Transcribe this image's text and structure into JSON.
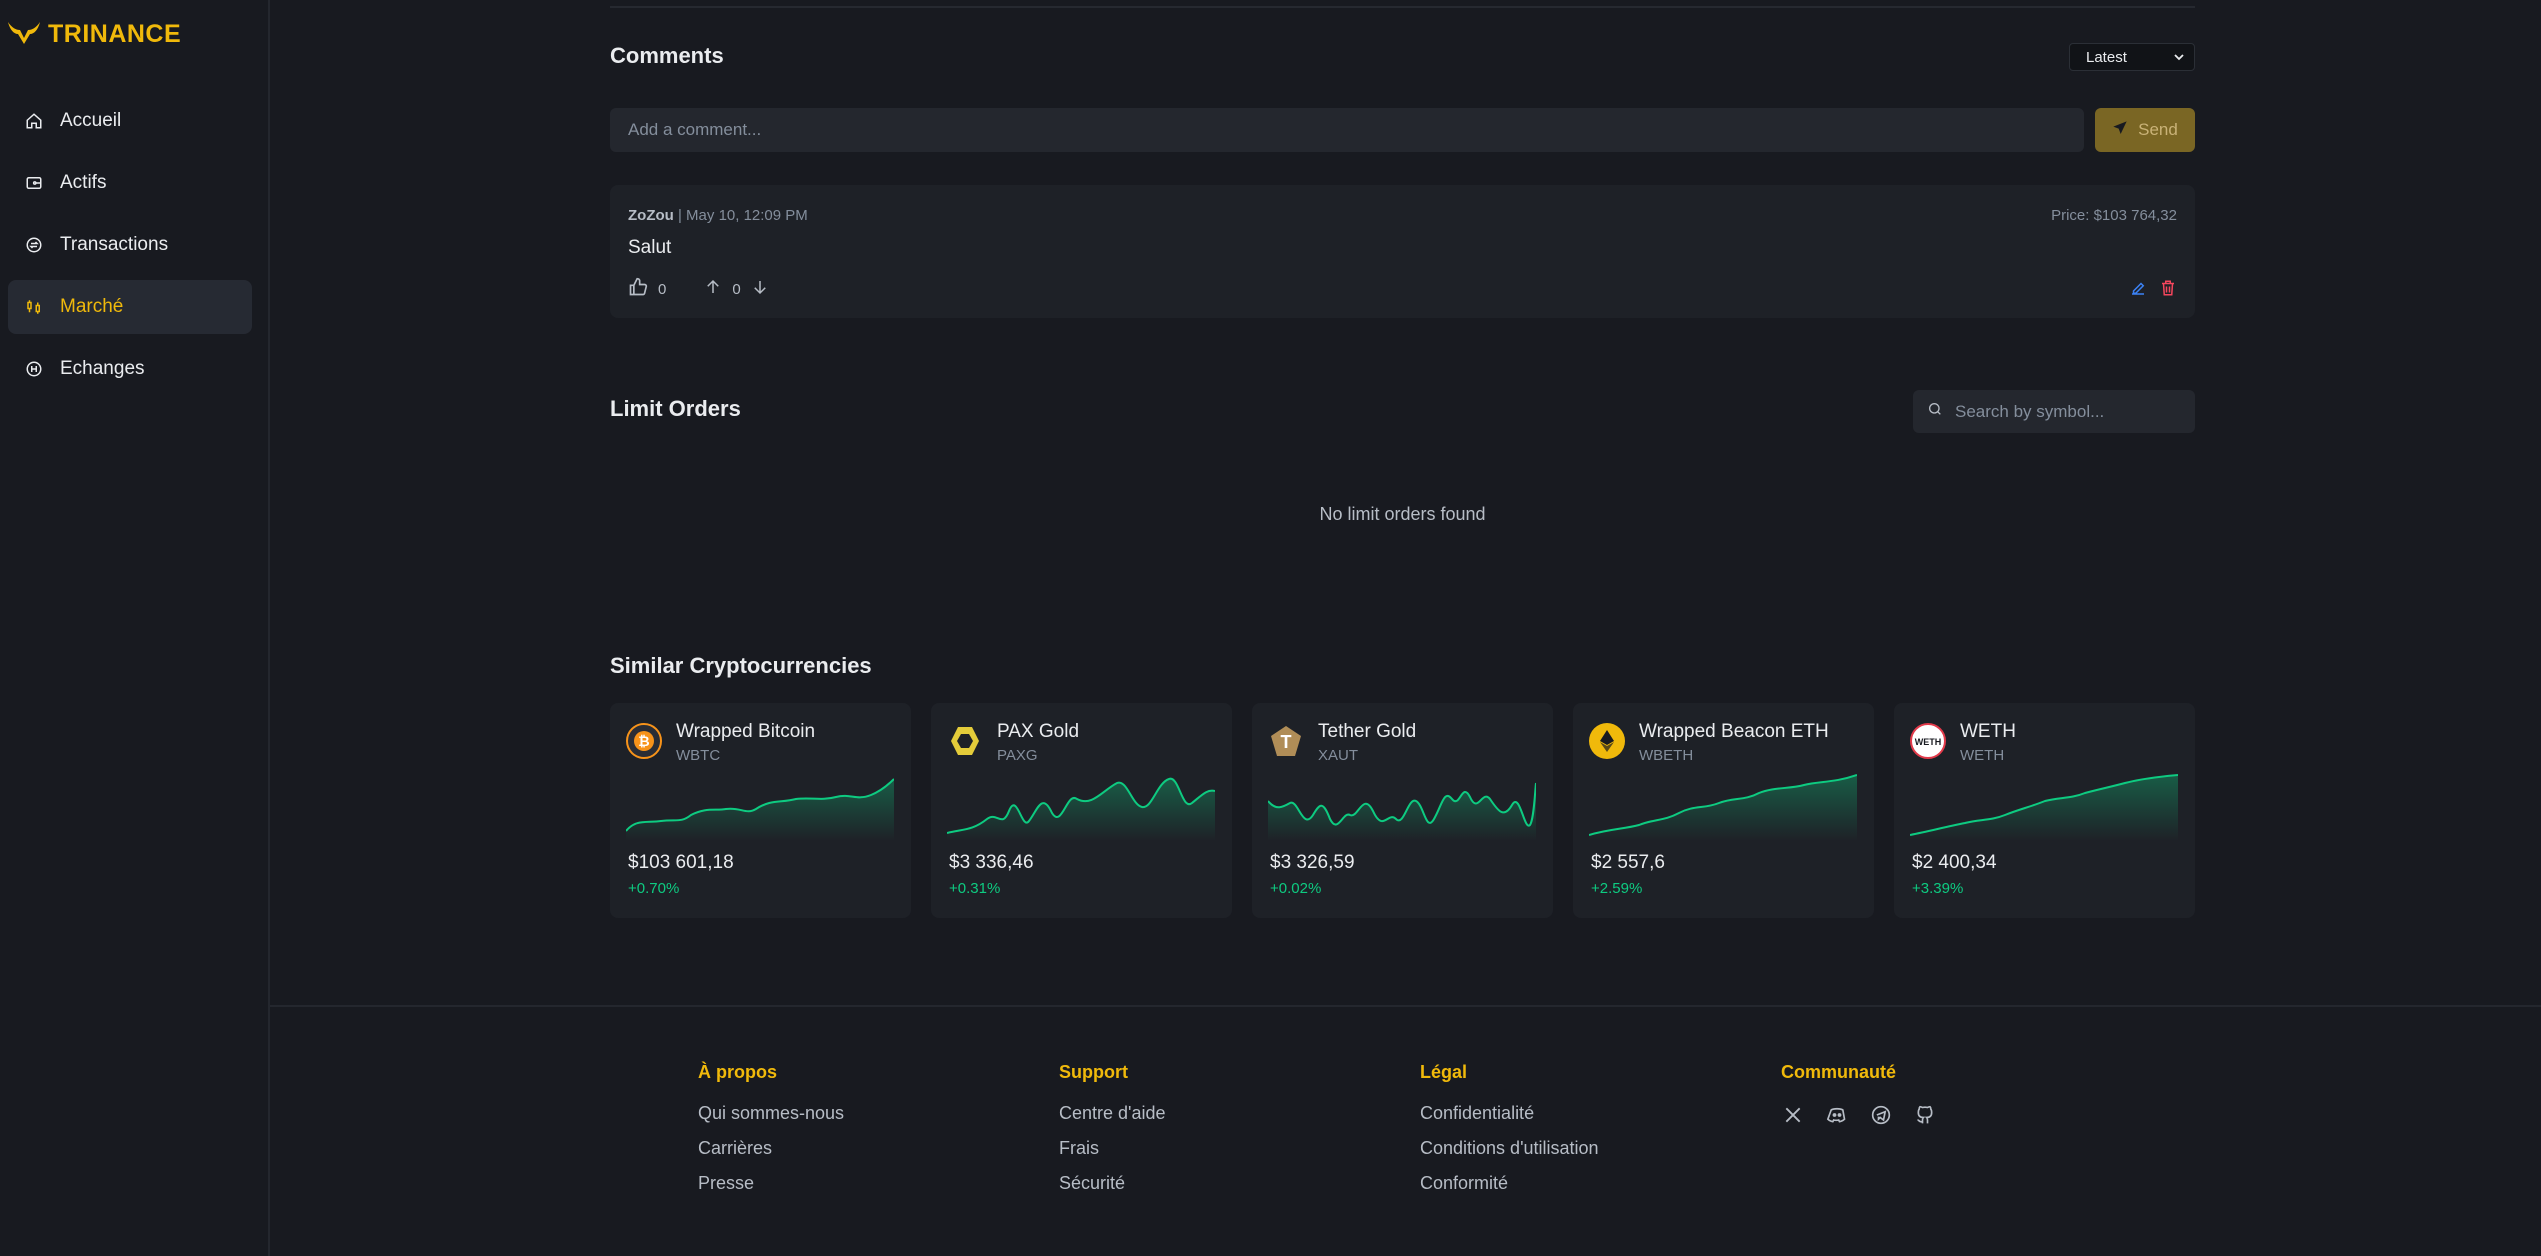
{
  "brand": {
    "name": "TRINANCE",
    "accent": "#f0b90b"
  },
  "sidebar": {
    "items": [
      {
        "label": "Accueil",
        "icon": "home-icon"
      },
      {
        "label": "Actifs",
        "icon": "wallet-icon"
      },
      {
        "label": "Transactions",
        "icon": "transactions-icon"
      },
      {
        "label": "Marché",
        "icon": "market-icon",
        "active": true
      },
      {
        "label": "Echanges",
        "icon": "exchange-icon"
      }
    ]
  },
  "comments": {
    "title": "Comments",
    "sort": "Latest",
    "input_placeholder": "Add a comment...",
    "send_label": "Send",
    "items": [
      {
        "author": "ZoZou",
        "meta": " | May 10, 12:09 PM",
        "price": "Price: $103 764,32",
        "text": "Salut",
        "likes": "0",
        "votes": "0"
      }
    ]
  },
  "limit_orders": {
    "title": "Limit Orders",
    "search_placeholder": "Search by symbol...",
    "empty": "No limit orders found"
  },
  "similar": {
    "title": "Similar Cryptocurrencies",
    "positive_color": "#0ecb81",
    "items": [
      {
        "name": "Wrapped Bitcoin",
        "symbol": "WBTC",
        "price": "$103 601,18",
        "change": "+0.70%",
        "icon": "bitcoin-icon"
      },
      {
        "name": "PAX Gold",
        "symbol": "PAXG",
        "price": "$3 336,46",
        "change": "+0.31%",
        "icon": "paxg-icon"
      },
      {
        "name": "Tether Gold",
        "symbol": "XAUT",
        "price": "$3 326,59",
        "change": "+0.02%",
        "icon": "tether-gold-icon"
      },
      {
        "name": "Wrapped Beacon ETH",
        "symbol": "WBETH",
        "price": "$2 557,6",
        "change": "+2.59%",
        "icon": "ethereum-icon"
      },
      {
        "name": "WETH",
        "symbol": "WETH",
        "price": "$2 400,34",
        "change": "+3.39%",
        "icon": "weth-icon"
      }
    ]
  },
  "footer": {
    "columns": [
      {
        "title": "À propos",
        "links": [
          "Qui sommes-nous",
          "Carrières",
          "Presse"
        ]
      },
      {
        "title": "Support",
        "links": [
          "Centre d'aide",
          "Frais",
          "Sécurité"
        ]
      },
      {
        "title": "Légal",
        "links": [
          "Confidentialité",
          "Conditions d'utilisation",
          "Conformité"
        ]
      },
      {
        "title": "Communauté",
        "social": [
          "x-icon",
          "discord-icon",
          "telegram-icon",
          "github-icon"
        ]
      }
    ]
  }
}
